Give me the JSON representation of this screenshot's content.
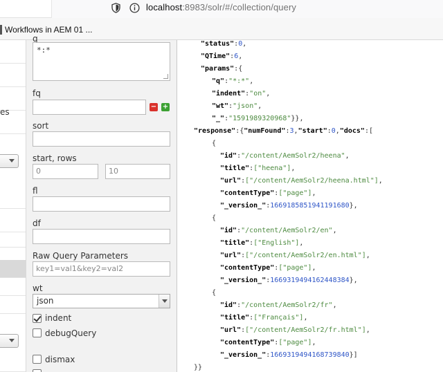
{
  "browser": {
    "url_host": "localhost",
    "url_path": ":8983/solr/#/collection/query",
    "bookmark": "Workflows in AEM 01 ..."
  },
  "leftnav": {
    "truncated_label": "es"
  },
  "form": {
    "q_label": "q",
    "q_value": "*:*",
    "fq_label": "fq",
    "sort_label": "sort",
    "start_rows_label": "start, rows",
    "start_placeholder": "0",
    "rows_placeholder": "10",
    "fl_label": "fl",
    "df_label": "df",
    "raw_label": "Raw Query Parameters",
    "raw_placeholder": "key1=val1&key2=val2",
    "wt_label": "wt",
    "wt_value": "json",
    "indent_label": "indent",
    "indent_checked": true,
    "debug_label": "debugQuery",
    "debug_checked": false,
    "dismax_label": "dismax",
    "dismax_checked": false,
    "minus_glyph": "−",
    "plus_glyph": "+"
  },
  "response": {
    "header": {
      "status": "0",
      "qtime": "6",
      "q": "\"*:*\"",
      "indent": "\"on\"",
      "wt": "\"json\"",
      "underscore": "\"1591989320968\""
    },
    "num_found": "3",
    "start": "0",
    "docs": [
      {
        "id": "\"/content/AemSolr2/heena\"",
        "title": "[\"heena\"]",
        "url": "[\"/content/AemSolr2/heena.html\"]",
        "content_type": "[\"page\"]",
        "version": "1669185851941191680"
      },
      {
        "id": "\"/content/AemSolr2/en\"",
        "title": "[\"English\"]",
        "url": "[\"/content/AemSolr2/en.html\"]",
        "content_type": "[\"page\"]",
        "version": "1669319494162448384"
      },
      {
        "id": "\"/content/AemSolr2/fr\"",
        "title": "[\"Français\"]",
        "url": "[\"/content/AemSolr2/fr.html\"]",
        "content_type": "[\"page\"]",
        "version": "1669319494168739840"
      }
    ]
  },
  "colors": {
    "string": "#4c8a3f",
    "number": "#2e55c7",
    "selected_nav": "#d9d9d9",
    "form_bg": "#f2f2f2"
  }
}
